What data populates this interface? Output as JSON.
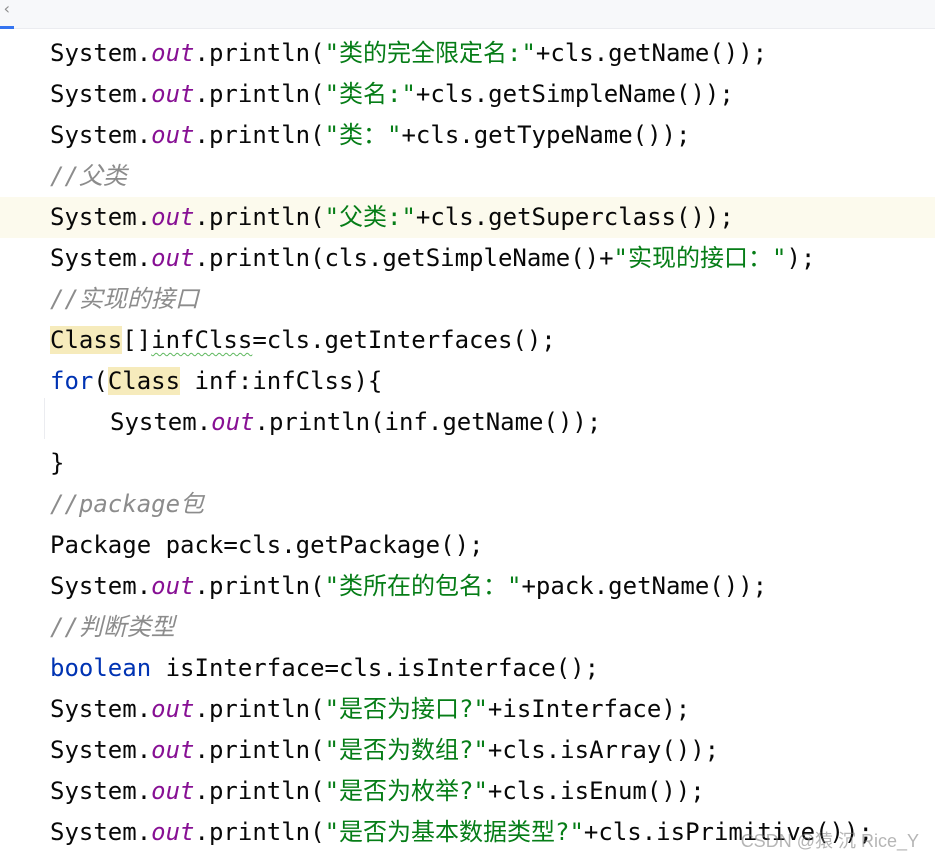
{
  "tab_chevron": "‹",
  "watermark": "CSDN @猿 沉 Rice_Y",
  "lines": [
    [
      "System.",
      "out",
      ".println(",
      "\"类的完全限定名:\"",
      "+cls.getName());"
    ],
    [
      "System.",
      "out",
      ".println(",
      "\"类名:\"",
      "+cls.getSimpleName());"
    ],
    [
      "System.",
      "out",
      ".println(",
      "\"类：\"",
      "+cls.getTypeName());"
    ],
    [
      "//父类"
    ],
    [
      "System.",
      "out",
      ".println(",
      "\"父类:\"",
      "+cls.getSuperclass());"
    ],
    [
      "System.",
      "out",
      ".println(cls.getSimpleName()+",
      "\"实现的接口：\"",
      ");"
    ],
    [
      "//实现的接口"
    ],
    [
      "Class",
      "[]",
      "infClss",
      "=cls.getInterfaces();"
    ],
    [
      "for",
      "(",
      "Class",
      " inf:infClss){"
    ],
    [
      "System.",
      "out",
      ".println(inf.getName());"
    ],
    [
      "}"
    ],
    [
      "//package包"
    ],
    [
      "Package pack=cls.getPackage();"
    ],
    [
      "System.",
      "out",
      ".println(",
      "\"类所在的包名：\"",
      "+pack.getName());"
    ],
    [
      "//判断类型"
    ],
    [
      "boolean",
      " isInterface=cls.isInterface();"
    ],
    [
      "System.",
      "out",
      ".println(",
      "\"是否为接口?\"",
      "+isInterface);"
    ],
    [
      "System.",
      "out",
      ".println(",
      "\"是否为数组?\"",
      "+cls.isArray());"
    ],
    [
      "System.",
      "out",
      ".println(",
      "\"是否为枚举?\"",
      "+cls.isEnum());"
    ],
    [
      "System.",
      "out",
      ".println(",
      "\"是否为基本数据类型?\"",
      "+cls.isPrimitive());"
    ]
  ]
}
